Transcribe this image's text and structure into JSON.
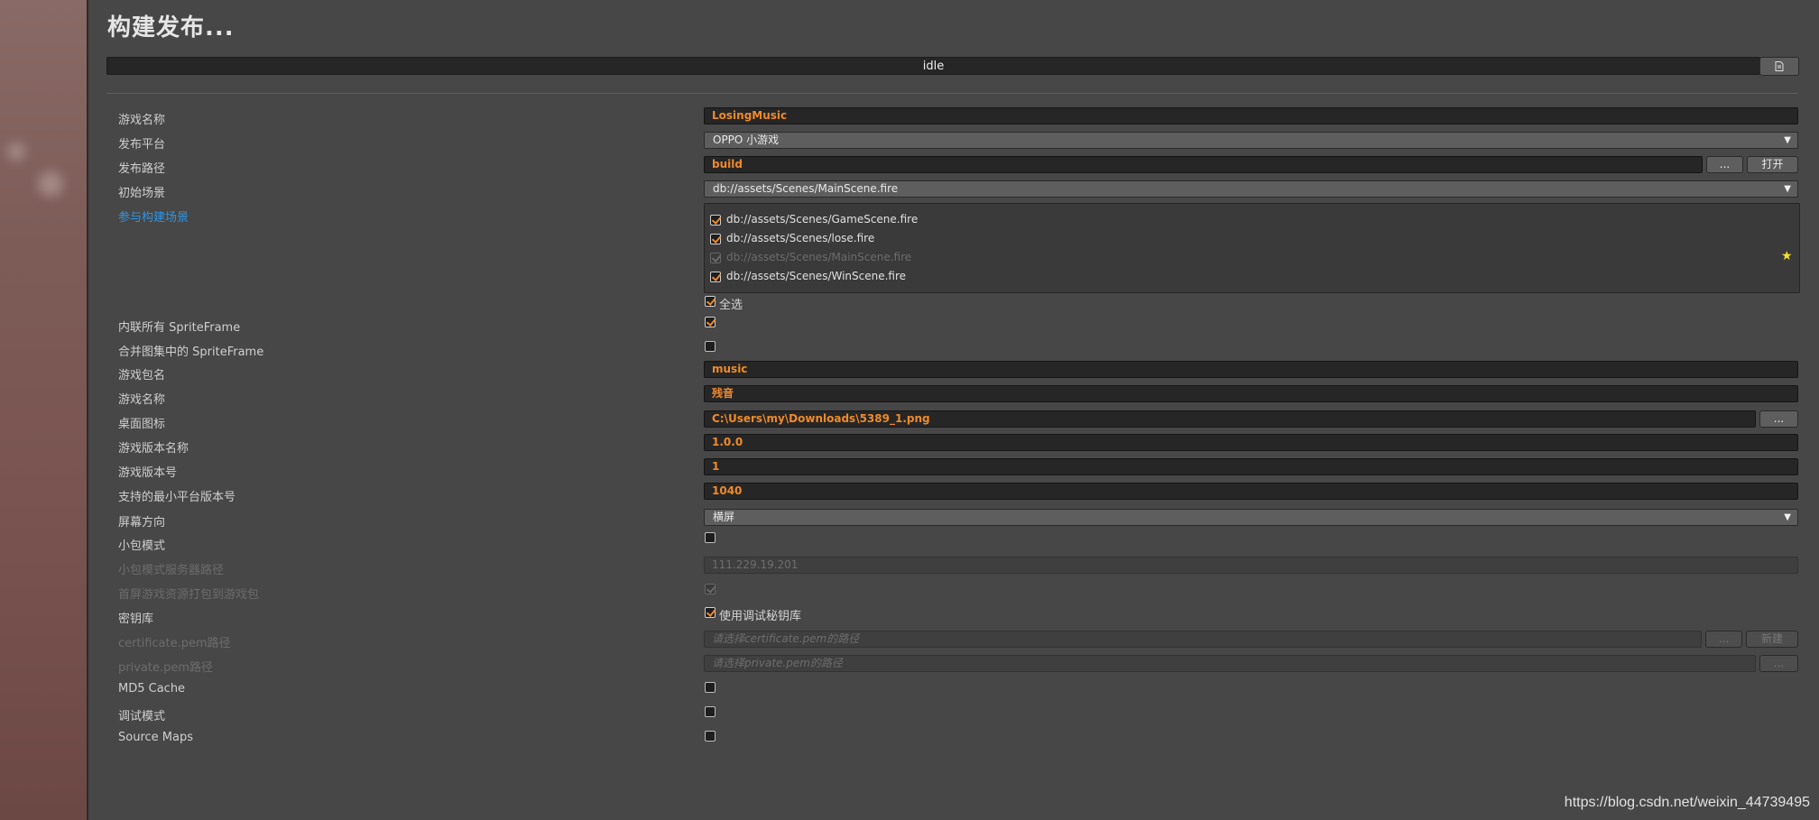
{
  "title": "构建发布...",
  "progress": {
    "status": "idle"
  },
  "log_button_icon": "document-icon",
  "fields": {
    "game_name": {
      "label": "游戏名称",
      "value": "LosingMusic"
    },
    "platform": {
      "label": "发布平台",
      "value": "OPPO 小游戏"
    },
    "build_path": {
      "label": "发布路径",
      "value": "build",
      "browse": "...",
      "open": "打开"
    },
    "start_scene": {
      "label": "初始场景",
      "value": "db://assets/Scenes/MainScene.fire"
    },
    "scenes_label": "参与构建场景",
    "scenes": [
      {
        "path": "db://assets/Scenes/GameScene.fire",
        "checked": true,
        "disabled": false
      },
      {
        "path": "db://assets/Scenes/lose.fire",
        "checked": true,
        "disabled": false
      },
      {
        "path": "db://assets/Scenes/MainScene.fire",
        "checked": true,
        "disabled": true
      },
      {
        "path": "db://assets/Scenes/WinScene.fire",
        "checked": true,
        "disabled": false
      }
    ],
    "select_all": "全选",
    "inline_sprite": {
      "label": "内联所有 SpriteFrame",
      "checked": true
    },
    "merge_sprite": {
      "label": "合并图集中的 SpriteFrame",
      "checked": false
    },
    "package_name": {
      "label": "游戏包名",
      "value": "music"
    },
    "display_name": {
      "label": "游戏名称",
      "value": "残音"
    },
    "desktop_icon": {
      "label": "桌面图标",
      "value": "C:\\Users\\my\\Downloads\\5389_1.png",
      "browse": "..."
    },
    "version_name": {
      "label": "游戏版本名称",
      "value": "1.0.0"
    },
    "version_number": {
      "label": "游戏版本号",
      "value": "1"
    },
    "min_platform": {
      "label": "支持的最小平台版本号",
      "value": "1040"
    },
    "orientation": {
      "label": "屏幕方向",
      "value": "横屏"
    },
    "small_pack": {
      "label": "小包模式",
      "checked": false
    },
    "small_pack_server": {
      "label": "小包模式服务器路径",
      "value": "111.229.19.201"
    },
    "first_screen": {
      "label": "首屏游戏资源打包到游戏包",
      "checked": true
    },
    "keystore": {
      "label": "密钥库",
      "checked": true,
      "option": "使用调试秘钥库"
    },
    "certificate": {
      "label": "certificate.pem路径",
      "placeholder": "请选择certificate.pem的路径",
      "browse": "...",
      "create": "新建"
    },
    "private_key": {
      "label": "private.pem路径",
      "placeholder": "请选择private.pem的路径",
      "browse": "..."
    },
    "md5_cache": {
      "label": "MD5 Cache",
      "checked": false
    },
    "debug_mode": {
      "label": "调试模式",
      "checked": false
    },
    "source_maps": {
      "label": "Source Maps",
      "checked": false
    }
  },
  "watermark": "https://blog.csdn.net/weixin_44739495",
  "colors": {
    "accent": "#f08a2a",
    "link": "#2d96e6",
    "background": "#474747"
  }
}
